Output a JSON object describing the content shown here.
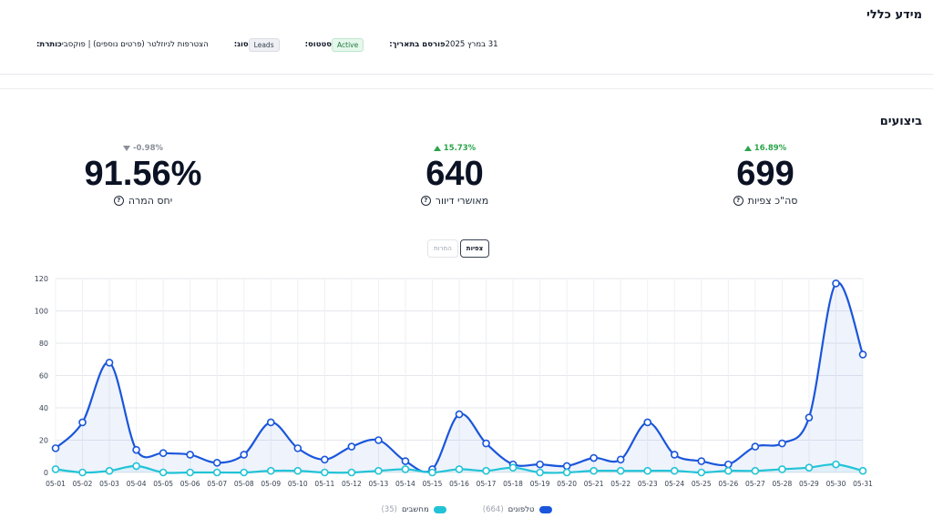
{
  "general": {
    "title": "מידע כללי",
    "fields": {
      "title_label": "כותרת:",
      "title_value": "הצטרפות לניוזלטר (פרטים נוספים) | פוקסבי",
      "type_label": "סוג:",
      "type_value": "Leads",
      "status_label": "סטטוס:",
      "status_value": "Active",
      "published_label": "פורסם בתאריך:",
      "published_value": "31 במרץ 2025"
    }
  },
  "performance": {
    "title": "ביצועים",
    "kpis": [
      {
        "value": "699",
        "label": "סה\"כ צפיות",
        "delta": "16.89%",
        "trend": "up"
      },
      {
        "value": "640",
        "label": "מאושרי דיוור",
        "delta": "15.73%",
        "trend": "up"
      },
      {
        "value": "91.56%",
        "label": "יחס המרה",
        "delta": "-0.98%",
        "trend": "down"
      }
    ],
    "toggle": {
      "views": "צפיות",
      "conversions": "המרות"
    }
  },
  "colors": {
    "phones": "#1a56db",
    "computers": "#22c3d6",
    "grid": "#e5e7eb"
  },
  "chart_data": {
    "type": "line",
    "x": [
      "05-01",
      "05-02",
      "05-03",
      "05-04",
      "05-05",
      "05-06",
      "05-07",
      "05-08",
      "05-09",
      "05-10",
      "05-11",
      "05-12",
      "05-13",
      "05-14",
      "05-15",
      "05-16",
      "05-17",
      "05-18",
      "05-19",
      "05-20",
      "05-21",
      "05-22",
      "05-23",
      "05-24",
      "05-25",
      "05-26",
      "05-27",
      "05-28",
      "05-29",
      "05-30",
      "05-31"
    ],
    "ylim": [
      0,
      120
    ],
    "yticks": [
      0,
      20,
      40,
      60,
      80,
      100,
      120
    ],
    "grid": true,
    "legend": "bottom-center",
    "series": [
      {
        "name": "טלפונים",
        "count": "(664)",
        "values": [
          15,
          31,
          68,
          14,
          12,
          11,
          6,
          11,
          31,
          15,
          8,
          16,
          20,
          7,
          2,
          36,
          18,
          5,
          5,
          4,
          9,
          8,
          31,
          11,
          7,
          5,
          16,
          18,
          34,
          117,
          73
        ]
      },
      {
        "name": "מחשבים",
        "count": "(35)",
        "values": [
          2,
          0,
          1,
          4,
          0,
          0,
          0,
          0,
          1,
          1,
          0,
          0,
          1,
          2,
          0,
          2,
          1,
          3,
          0,
          0,
          1,
          1,
          1,
          1,
          0,
          1,
          1,
          2,
          3,
          5,
          1
        ]
      }
    ]
  }
}
